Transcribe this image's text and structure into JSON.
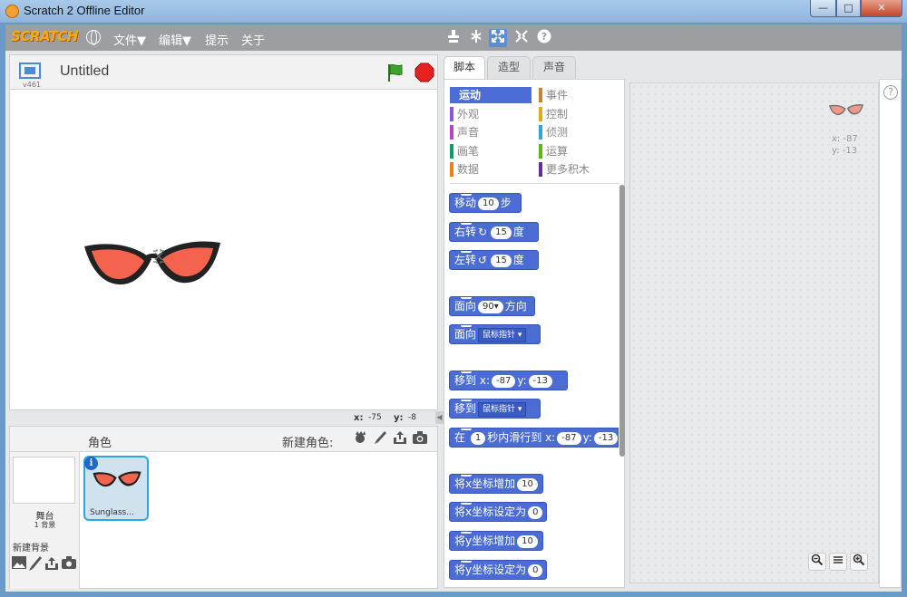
{
  "window": {
    "title": "Scratch 2 Offline Editor",
    "minimize": "—",
    "maximize": "□",
    "close": "✕"
  },
  "menubar": {
    "logo": "SCRATCH",
    "items": [
      "文件▼",
      "编辑▼",
      "提示",
      "关于"
    ],
    "tools": {
      "duplicate": "⚲",
      "cut": "✂",
      "grow": "✕",
      "shrink": "✕",
      "help": "?"
    }
  },
  "stage": {
    "version": "v461",
    "title": "Untitled",
    "mouse_x_label": "x:",
    "mouse_x": "-75",
    "mouse_y_label": "y:",
    "mouse_y": "-8"
  },
  "sprites": {
    "header": "角色",
    "new_sprite_label": "新建角色:",
    "stage_name": "舞台",
    "backdrop_count": "1 背景",
    "new_backdrop_label": "新建背景",
    "list": [
      {
        "name": "Sunglass..."
      }
    ]
  },
  "tabs": [
    "脚本",
    "造型",
    "声音"
  ],
  "categories": [
    {
      "label": "运动",
      "color": "#4a6cd4",
      "active": true
    },
    {
      "label": "外观",
      "color": "#8a55d7"
    },
    {
      "label": "声音",
      "color": "#bb42c3"
    },
    {
      "label": "画笔",
      "color": "#0e9a6c"
    },
    {
      "label": "数据",
      "color": "#ee7d16"
    },
    {
      "label": "事件",
      "color": "#c88330"
    },
    {
      "label": "控制",
      "color": "#e1a91a"
    },
    {
      "label": "侦测",
      "color": "#2ca5e2"
    },
    {
      "label": "运算",
      "color": "#5cb712"
    },
    {
      "label": "更多积木",
      "color": "#632d99"
    }
  ],
  "blocks": {
    "move": {
      "a": "移动",
      "n": "10",
      "b": "步"
    },
    "turn_right": {
      "a": "右转",
      "arrow": "↻",
      "n": "15",
      "b": "度"
    },
    "turn_left": {
      "a": "左转",
      "arrow": "↺",
      "n": "15",
      "b": "度"
    },
    "point_dir": {
      "a": "面向",
      "n": "90▾",
      "b": "方向"
    },
    "point_towards": {
      "a": "面向",
      "dd": "鼠标指针"
    },
    "goto_xy": {
      "a": "移到",
      "x": "x:",
      "xv": "-87",
      "y": "y:",
      "yv": "-13"
    },
    "goto": {
      "a": "移到",
      "dd": "鼠标指针"
    },
    "glide": {
      "a": "在",
      "n": "1",
      "b": "秒内滑行到",
      "x": "x:",
      "xv": "-87",
      "y": "y:",
      "yv": "-13"
    },
    "change_x": {
      "a": "将x坐标增加",
      "n": "10"
    },
    "set_x": {
      "a": "将x坐标设定为",
      "n": "0"
    },
    "change_y": {
      "a": "将y坐标增加",
      "n": "10"
    },
    "set_y": {
      "a": "将y坐标设定为",
      "n": "0"
    }
  },
  "scripts": {
    "sprite_x": "x: -87",
    "sprite_y": "y: -13",
    "help": "?"
  }
}
